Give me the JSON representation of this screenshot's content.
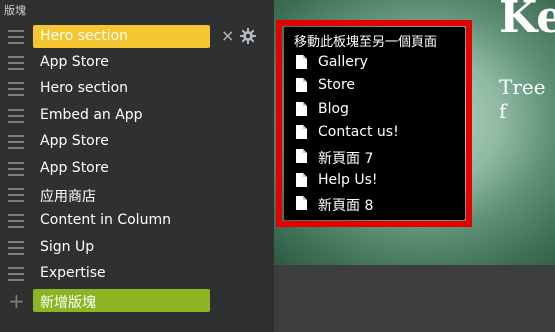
{
  "panel": {
    "title": "版塊",
    "items": [
      {
        "label": "Hero section",
        "active": true
      },
      {
        "label": "App Store"
      },
      {
        "label": "Hero section"
      },
      {
        "label": "Embed an App"
      },
      {
        "label": "App Store"
      },
      {
        "label": "App Store"
      },
      {
        "label": "应用商店"
      },
      {
        "label": "Content in Column"
      },
      {
        "label": "Sign Up"
      },
      {
        "label": "Expertise"
      }
    ],
    "close_glyph": "×",
    "add_glyph": "+",
    "add_label": "新增版塊"
  },
  "content": {
    "hero_title": "Ke",
    "hero_sub": "Tree f"
  },
  "popup": {
    "title": "移動此板塊至另一個頁面",
    "pages": [
      "Gallery",
      "Store",
      "Blog",
      "Contact us!",
      "新頁面 7",
      "Help Us!",
      "新頁面 8"
    ]
  },
  "colors": {
    "active_pill": "#f6c630",
    "add_pill": "#8cb523",
    "popup_outline": "#e50000"
  },
  "icons": {
    "drag": "drag-handle-icon",
    "close": "close-icon",
    "settings": "gear-icon",
    "add": "plus-icon",
    "page": "page-icon"
  }
}
